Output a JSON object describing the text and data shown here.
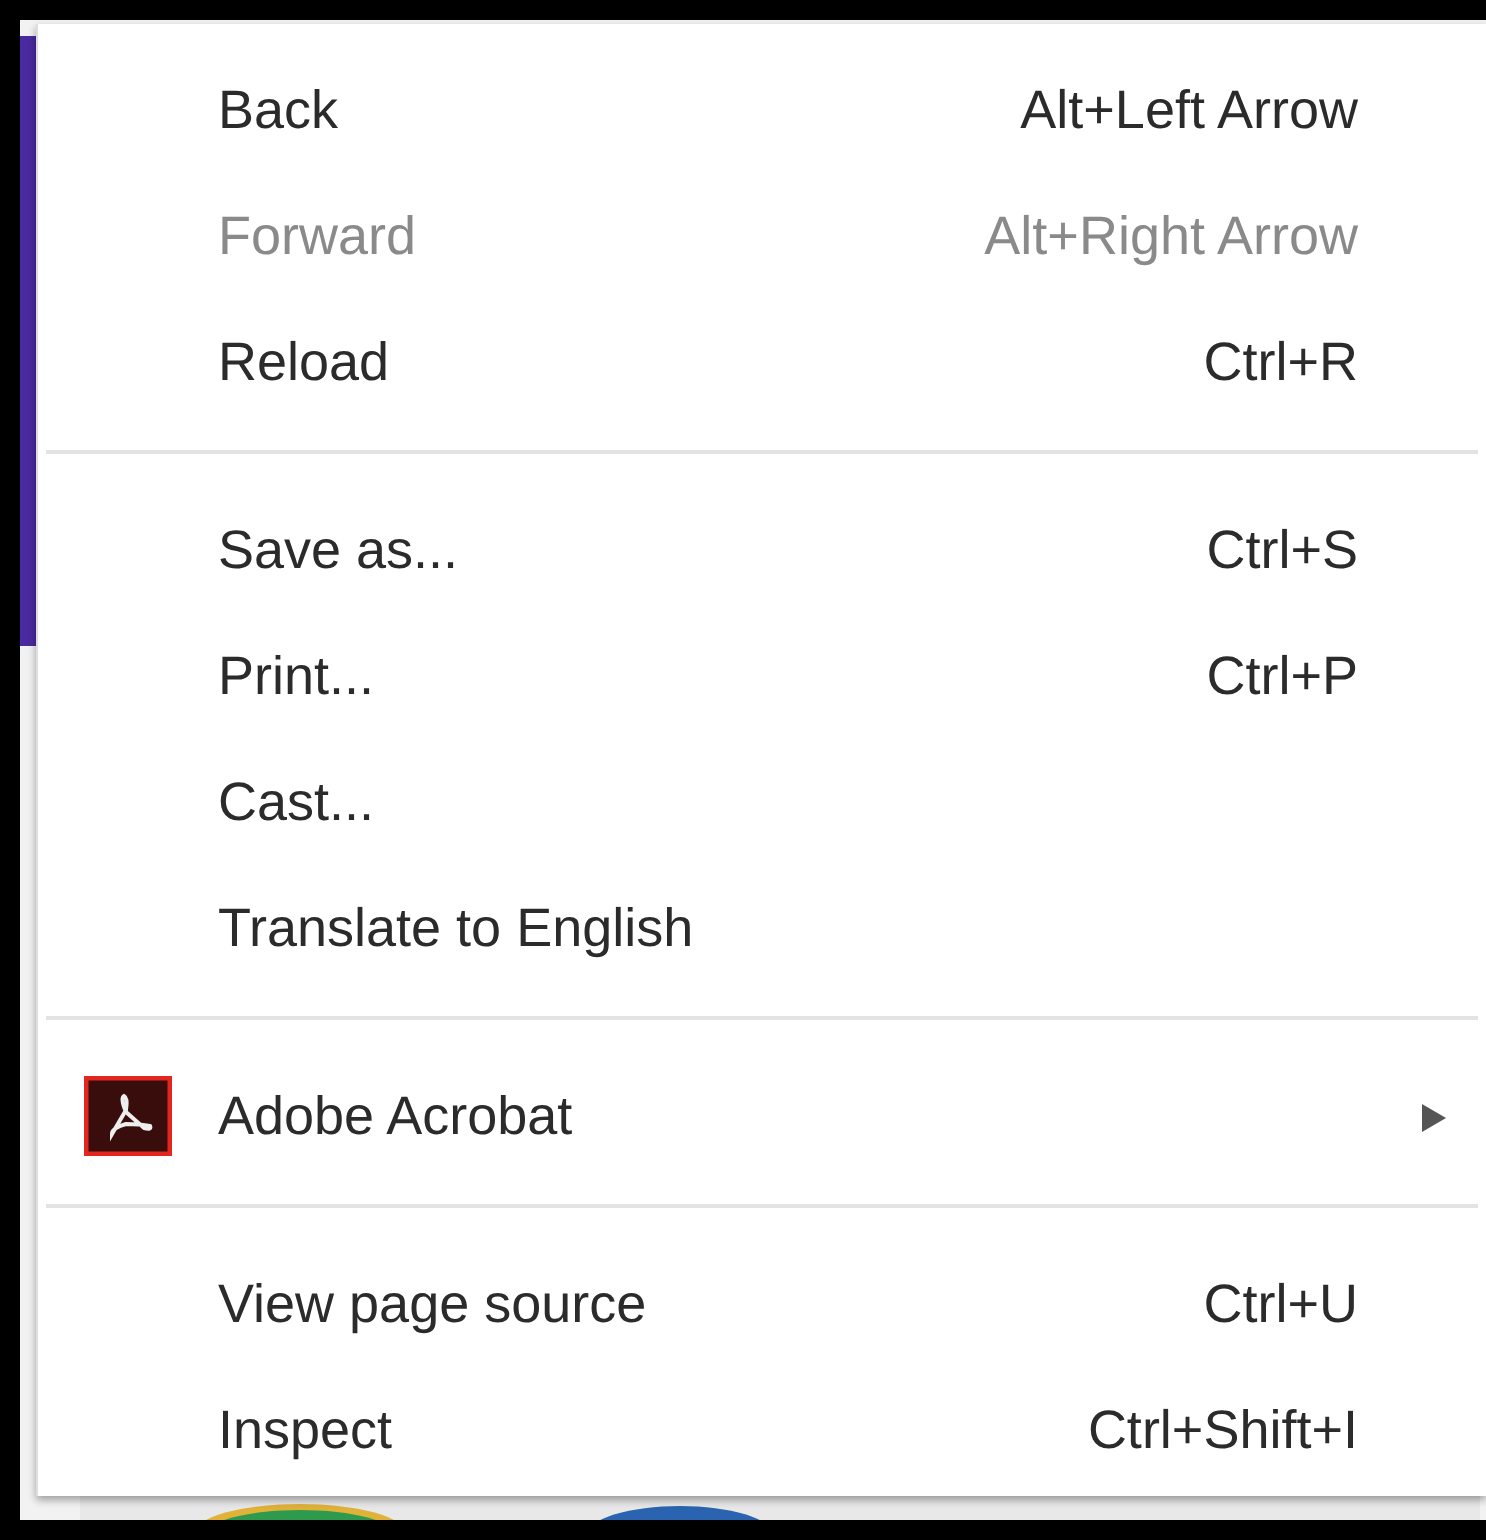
{
  "context_menu": {
    "sections": [
      {
        "items": [
          {
            "kind": "command",
            "label": "Back",
            "shortcut": "Alt+Left Arrow",
            "disabled": false
          },
          {
            "kind": "command",
            "label": "Forward",
            "shortcut": "Alt+Right Arrow",
            "disabled": true
          },
          {
            "kind": "command",
            "label": "Reload",
            "shortcut": "Ctrl+R",
            "disabled": false
          }
        ]
      },
      {
        "items": [
          {
            "kind": "command",
            "label": "Save as...",
            "shortcut": "Ctrl+S",
            "disabled": false
          },
          {
            "kind": "command",
            "label": "Print...",
            "shortcut": "Ctrl+P",
            "disabled": false
          },
          {
            "kind": "command",
            "label": "Cast...",
            "disabled": false
          },
          {
            "kind": "command",
            "label": "Translate to English",
            "disabled": false
          }
        ]
      },
      {
        "items": [
          {
            "kind": "submenu",
            "label": "Adobe Acrobat",
            "disabled": false
          }
        ]
      },
      {
        "items": [
          {
            "kind": "command",
            "label": "View page source",
            "shortcut": "Ctrl+U",
            "disabled": false
          },
          {
            "kind": "command",
            "label": "Inspect",
            "shortcut": "Ctrl+Shift+I",
            "disabled": false
          }
        ]
      }
    ]
  }
}
